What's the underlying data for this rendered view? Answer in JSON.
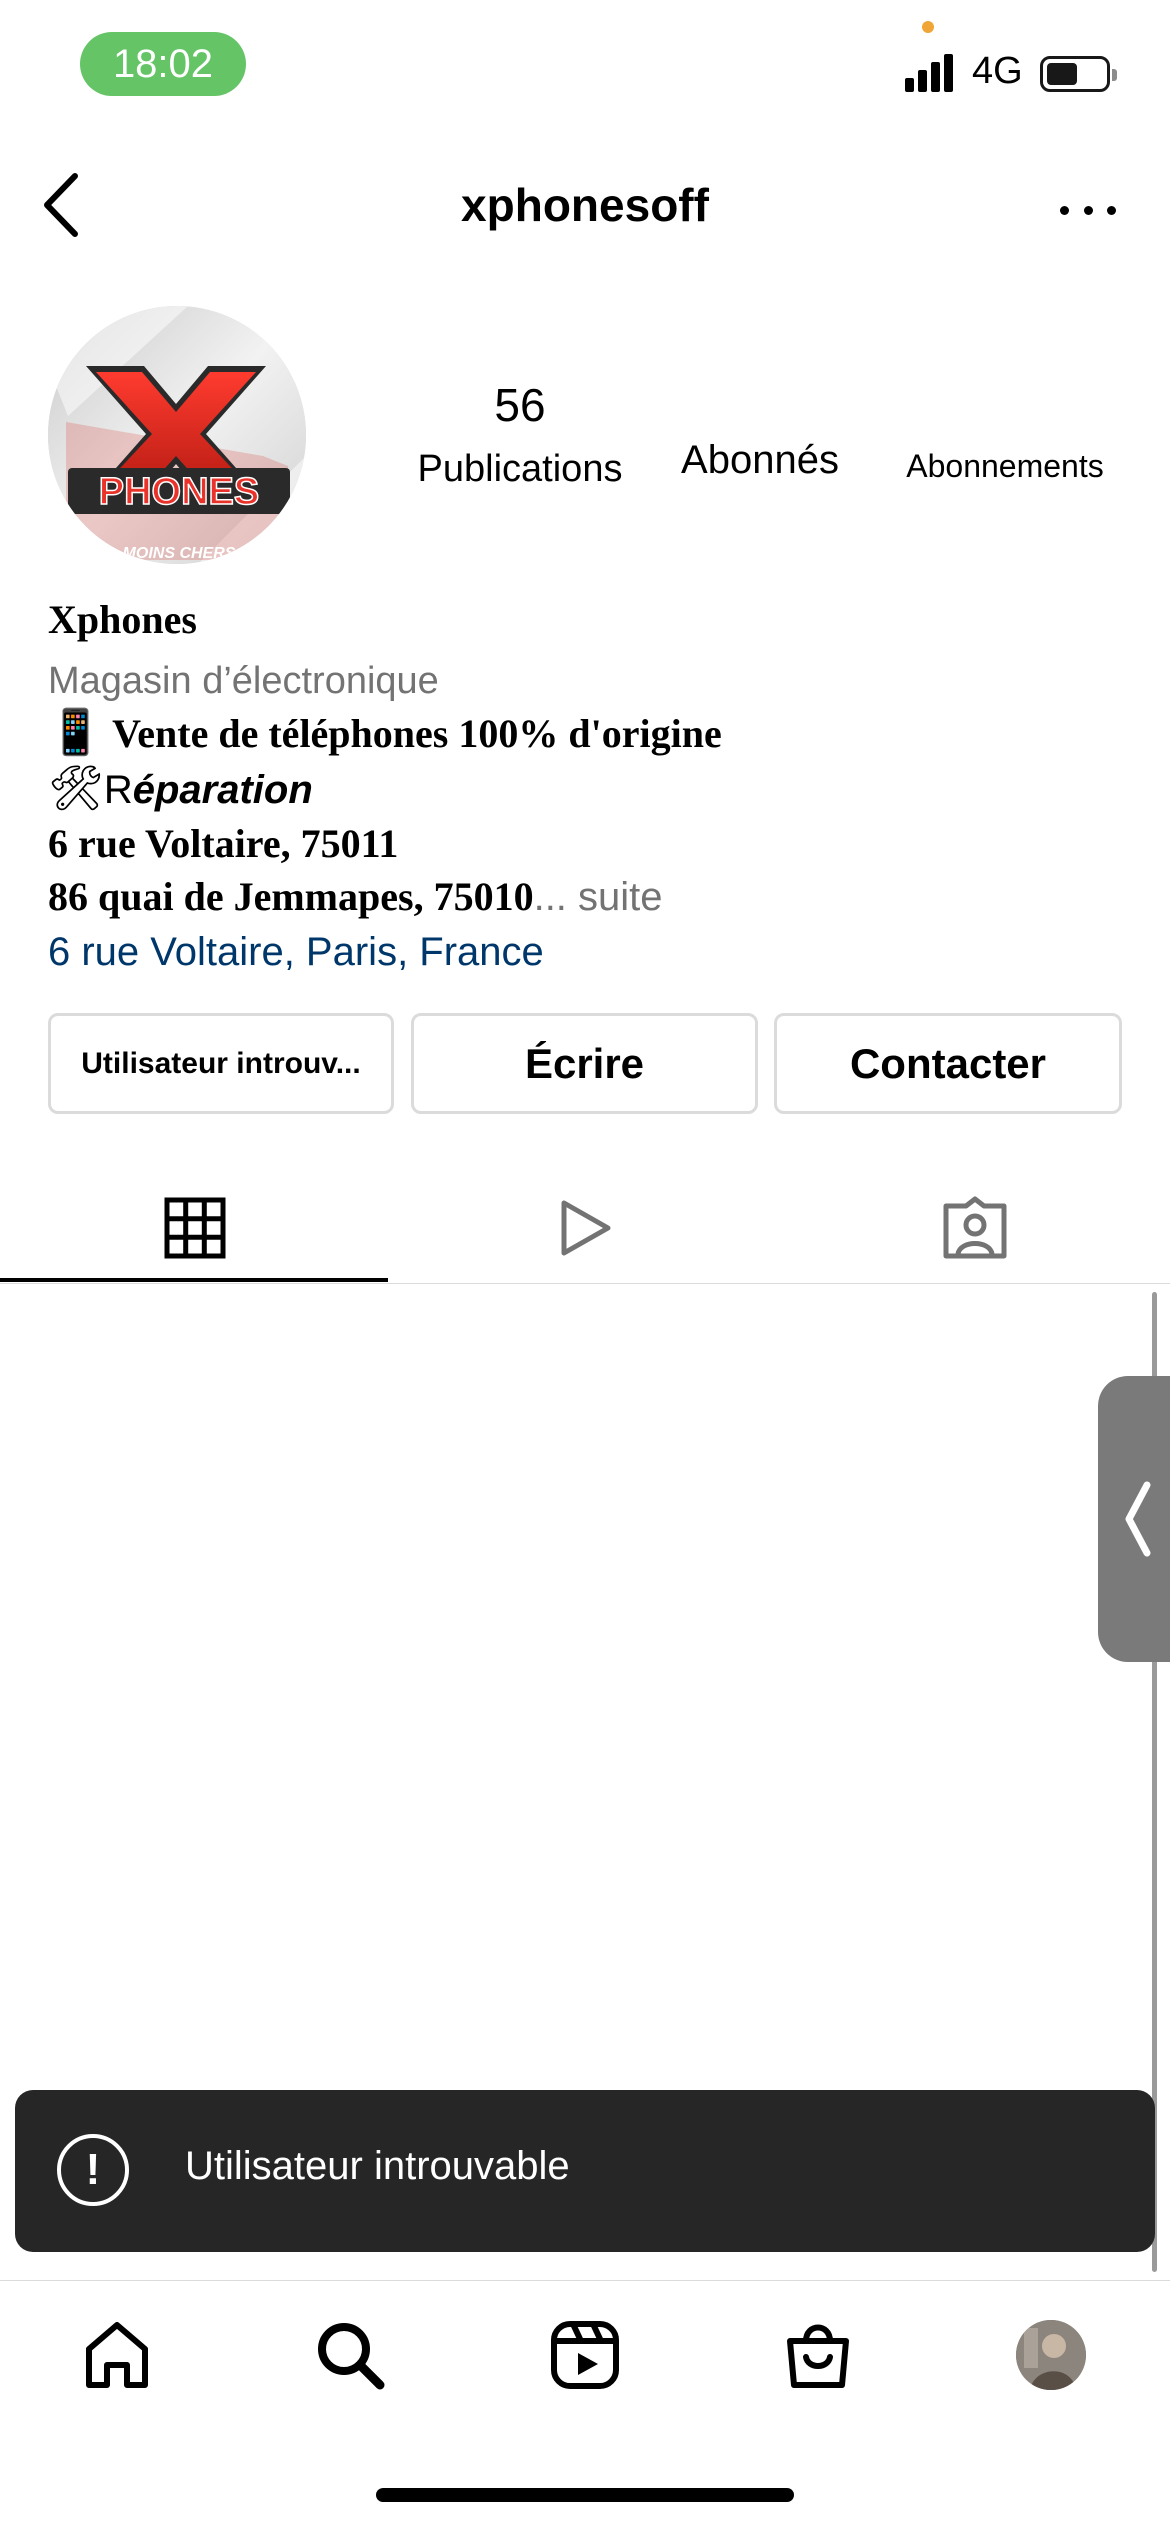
{
  "status_bar": {
    "time": "18:02",
    "network": "4G",
    "time_pill_color": "#65c466",
    "dot_color": "#f0a537"
  },
  "header": {
    "username": "xphonesoff",
    "back_icon": "chevron-left-icon",
    "more_icon": "more-horizontal-icon"
  },
  "profile": {
    "avatar_logo_letter": "X",
    "avatar_logo_word": "PHONES",
    "avatar_tagline": "MOINS CHERS",
    "stats": [
      {
        "value": "56",
        "label": "Publications"
      },
      {
        "value": "",
        "label": "Abonnés"
      },
      {
        "value": "",
        "label": "Abonnements"
      }
    ]
  },
  "bio": {
    "name": "Xphones",
    "category": "Magasin d’électronique",
    "line1_emoji": "📱",
    "line1_text": " Vente de téléphones 100% d'origine",
    "line2_emoji": "🛠",
    "line2_plain": "R",
    "line2_italic": "éparation",
    "line3": "6 rue Voltaire, 75011",
    "line4": "86 quai de Jemmapes, 75010",
    "more": "... suite",
    "link": "6 rue Voltaire, Paris, France"
  },
  "actions": {
    "follow_state": "Utilisateur introuv...",
    "message": "Écrire",
    "contact": "Contacter"
  },
  "tabs": [
    {
      "icon": "grid-icon",
      "active": true
    },
    {
      "icon": "reels-play-icon",
      "active": false
    },
    {
      "icon": "tagged-person-icon",
      "active": false
    }
  ],
  "toast": {
    "icon": "!",
    "message": "Utilisateur introuvable",
    "background": "#262626"
  },
  "bottom_nav": [
    {
      "icon": "home-icon"
    },
    {
      "icon": "search-icon"
    },
    {
      "icon": "reels-icon"
    },
    {
      "icon": "shop-bag-icon"
    },
    {
      "icon": "profile-avatar-icon"
    }
  ],
  "colors": {
    "link": "#00376b",
    "secondary_text": "#737373",
    "border": "#dbdbdb"
  }
}
